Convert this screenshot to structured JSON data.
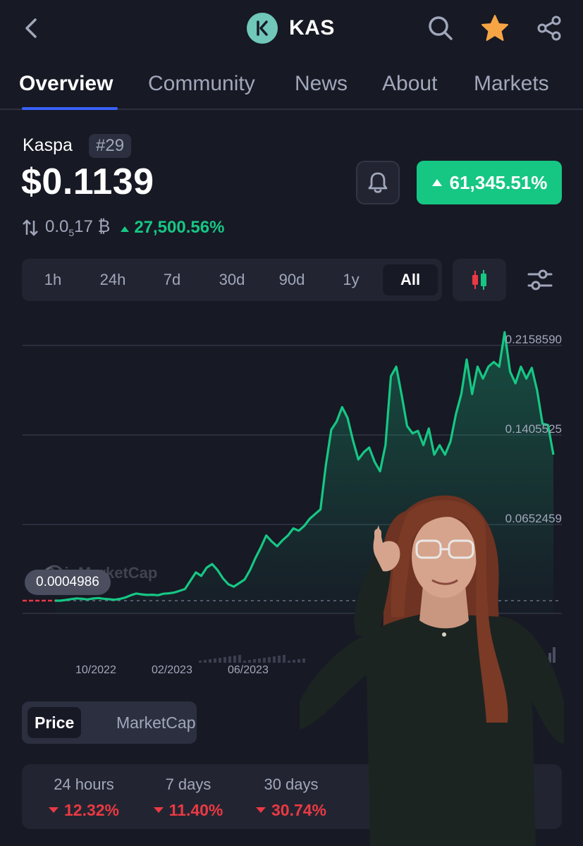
{
  "header": {
    "symbol": "KAS",
    "icons": [
      "back-chevron-icon",
      "search-icon",
      "star-icon",
      "share-icon"
    ],
    "star_color": "#f6a444"
  },
  "tabs": [
    {
      "label": "Overview",
      "active": true
    },
    {
      "label": "Community",
      "active": false
    },
    {
      "label": "News",
      "active": false
    },
    {
      "label": "About",
      "active": false
    },
    {
      "label": "Markets",
      "active": false
    }
  ],
  "coin": {
    "name": "Kaspa",
    "rank": "#29",
    "price": "$0.1139",
    "change_badge": "61,345.51%",
    "btc_price_prefix": "0.0",
    "btc_price_sub": "5",
    "btc_price_suffix": "17 ₿",
    "btc_change": "27,500.56%"
  },
  "ranges": [
    "1h",
    "24h",
    "7d",
    "30d",
    "90d",
    "1y",
    "All"
  ],
  "active_range": "All",
  "chart_data": {
    "type": "area",
    "watermark": "CoinMarketCap",
    "y_ticks": [
      "0.2158590",
      "0.1405525",
      "0.0652459"
    ],
    "start_value": "0.0004986",
    "x_ticks": [
      "10/2022",
      "02/2023",
      "06/2023"
    ],
    "series": [
      {
        "values": [
          0.0005,
          0.0012,
          0.0018,
          0.0025,
          0.0031,
          0.0028,
          0.0022,
          0.003,
          0.0034,
          0.0028,
          0.0024,
          0.002,
          0.0027,
          0.0039,
          0.0058,
          0.0072,
          0.0065,
          0.006,
          0.0062,
          0.0058,
          0.007,
          0.0074,
          0.008,
          0.0095,
          0.011,
          0.018,
          0.025,
          0.022,
          0.029,
          0.032,
          0.027,
          0.02,
          0.015,
          0.013,
          0.016,
          0.019,
          0.027,
          0.037,
          0.046,
          0.056,
          0.051,
          0.047,
          0.052,
          0.056,
          0.062,
          0.06,
          0.064,
          0.07,
          0.074,
          0.078,
          0.115,
          0.145,
          0.152,
          0.164,
          0.155,
          0.136,
          0.12,
          0.126,
          0.13,
          0.118,
          0.11,
          0.132,
          0.19,
          0.198,
          0.174,
          0.148,
          0.142,
          0.144,
          0.132,
          0.146,
          0.124,
          0.132,
          0.124,
          0.135,
          0.158,
          0.175,
          0.204,
          0.175,
          0.198,
          0.188,
          0.198,
          0.202,
          0.198,
          0.227,
          0.194,
          0.184,
          0.198,
          0.188,
          0.197,
          0.178,
          0.15,
          0.149,
          0.124
        ]
      }
    ],
    "colors": {
      "line": "#16c784",
      "grid": "#323546"
    }
  },
  "toggle": {
    "price": "Price",
    "marketcap": "MarketCap"
  },
  "stats": [
    {
      "label": "24 hours",
      "value": "12.32%"
    },
    {
      "label": "7 days",
      "value": "11.40%"
    },
    {
      "label": "30 days",
      "value": "30.74%"
    }
  ]
}
